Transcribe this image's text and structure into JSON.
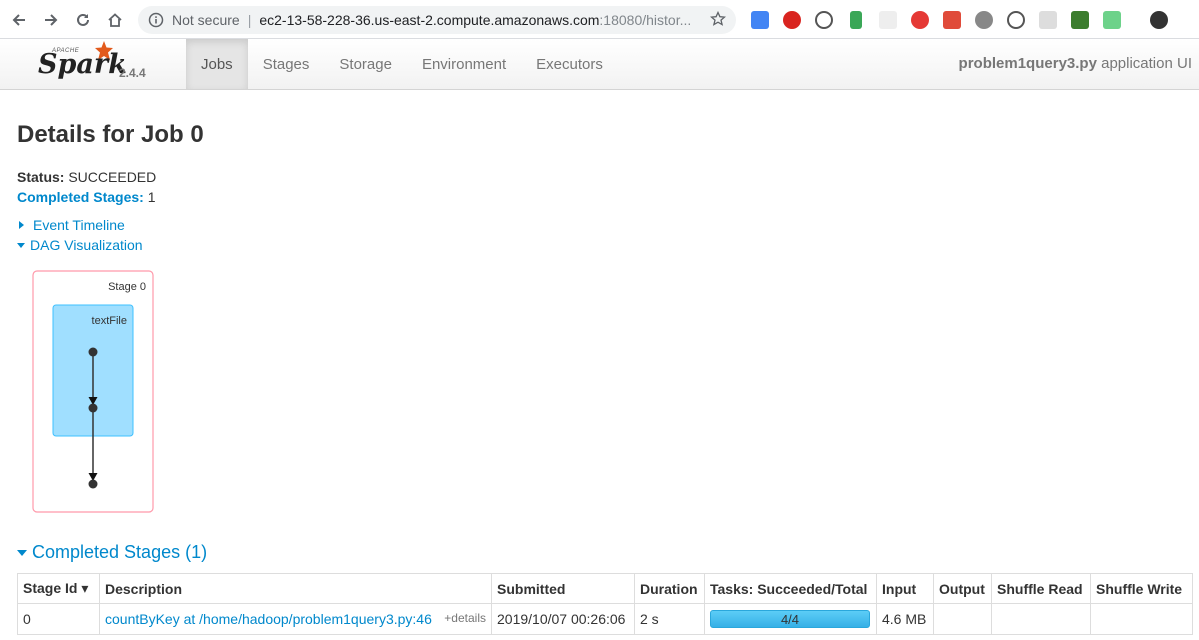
{
  "browser": {
    "not_secure": "Not secure",
    "url_host": "ec2-13-58-228-36.us-east-2.compute.amazonaws.com",
    "url_rest": ":18080/histor..."
  },
  "navbar": {
    "logo_apache": "APACHE",
    "logo_spark": "Spark",
    "version": "2.4.4",
    "tabs": [
      {
        "label": "Jobs",
        "active": true
      },
      {
        "label": "Stages",
        "active": false
      },
      {
        "label": "Storage",
        "active": false
      },
      {
        "label": "Environment",
        "active": false
      },
      {
        "label": "Executors",
        "active": false
      }
    ],
    "app_name": "problem1query3.py",
    "app_suffix": " application UI"
  },
  "page": {
    "title": "Details for Job 0",
    "status_label": "Status:",
    "status_value": "SUCCEEDED",
    "completed_label": "Completed Stages:",
    "completed_value": "1",
    "event_timeline": "Event Timeline",
    "dag_visualization": "DAG Visualization"
  },
  "dag": {
    "stage_label": "Stage 0",
    "rdd_label": "textFile"
  },
  "completed_stages": {
    "heading": "Completed Stages (1)",
    "columns": [
      "Stage Id ▾",
      "Description",
      "Submitted",
      "Duration",
      "Tasks: Succeeded/Total",
      "Input",
      "Output",
      "Shuffle Read",
      "Shuffle Write"
    ],
    "rows": [
      {
        "stage_id": "0",
        "description": "countByKey at /home/hadoop/problem1query3.py:46",
        "details": "+details",
        "submitted": "2019/10/07 00:26:06",
        "duration": "2 s",
        "tasks": "4/4",
        "tasks_fraction": 1.0,
        "input": "4.6 MB",
        "output": "",
        "shuffle_read": "",
        "shuffle_write": ""
      }
    ]
  },
  "colors": {
    "link": "#0088cc",
    "dag_stage_border": "#ff99aa",
    "dag_cluster_fill": "#a0dfff",
    "progress": "#4abff0"
  }
}
